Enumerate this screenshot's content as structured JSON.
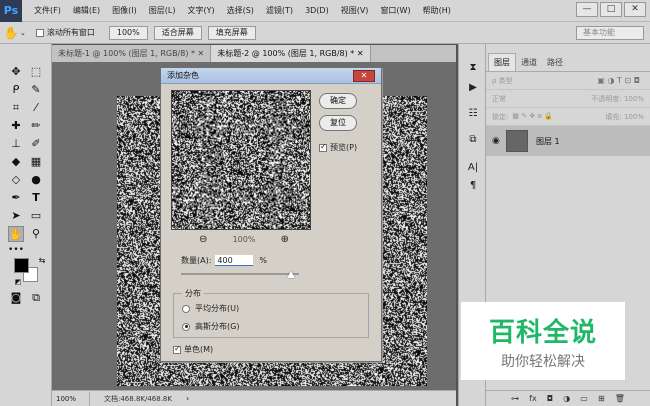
{
  "app": {
    "logo": "Ps"
  },
  "menubar": {
    "items": [
      "文件(F)",
      "编辑(E)",
      "图像(I)",
      "图层(L)",
      "文字(Y)",
      "选择(S)",
      "滤镜(T)",
      "3D(D)",
      "视图(V)",
      "窗口(W)",
      "帮助(H)"
    ],
    "window_controls": {
      "minimize": "—",
      "maximize": "□",
      "close": "✕"
    }
  },
  "options_bar": {
    "scroll_all_windows": "滚动所有窗口",
    "zoom_100": "100%",
    "fit_screen": "适合屏幕",
    "fill_screen": "填充屏幕",
    "workspace": "基本功能"
  },
  "doc_tabs": [
    {
      "label": "未标题-1 @ 100% (图层 1, RGB/8) * ✕"
    },
    {
      "label": "未标题-2 @ 100% (图层 1, RGB/8) * ✕"
    }
  ],
  "status_bar": {
    "zoom": "100%",
    "doc": "文档:468.8K/468.8K"
  },
  "layers_panel": {
    "tabs": [
      "图层",
      "通道",
      "路径"
    ],
    "filter_label": "ρ 类型",
    "blend_mode": "正常",
    "opacity": "不透明度: 100%",
    "lock_label": "锁定:",
    "fill": "填充: 100%",
    "layer_name": "图层 1"
  },
  "dialog": {
    "title": "添加杂色",
    "ok": "确定",
    "reset": "复位",
    "preview": "预览(P)",
    "zoom": "100%",
    "amount_label": "数量(A):",
    "amount_value": "400",
    "amount_unit": "%",
    "distribution_label": "分布",
    "uniform": "平均分布(U)",
    "gaussian": "高斯分布(G)",
    "monochromatic": "单色(M)"
  },
  "watermark": {
    "title": "百科全说",
    "subtitle": "助你轻松解决"
  }
}
